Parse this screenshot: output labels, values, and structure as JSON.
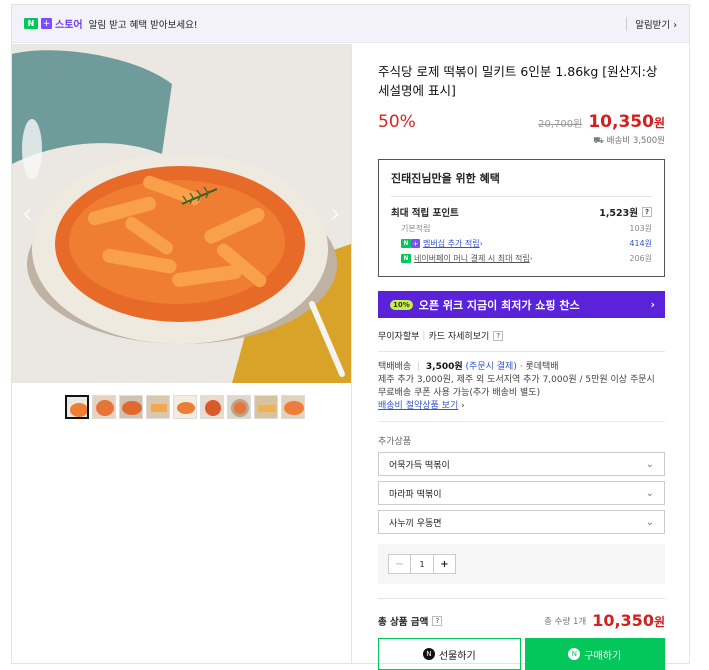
{
  "topbar": {
    "store_name": "스토어",
    "message": "알림 받고 혜택 받아보세요!",
    "alarm_label": "알림받기"
  },
  "product": {
    "title": "주식당 로제 떡볶이 밀키트 6인분 1.86kg [원산지:상세설명에 표시]",
    "discount": "50%",
    "original_price": "20,700원",
    "price": "10,350",
    "price_unit": "원",
    "shipping_fee": "배송비 3,500원"
  },
  "benefit": {
    "title": "진태진님만을 위한 혜택",
    "max_points_label": "최대 적립 포인트",
    "max_points_value": "1,523원",
    "basic_label": "기본적립",
    "basic_value": "103원",
    "membership_label": "멤버십 추가 적립",
    "membership_value": "414원",
    "npay_label": "네이버페이 머니 결제 시 최대 적립",
    "npay_value": "206원"
  },
  "banner": {
    "tag": "10%",
    "text": "오픈 위크 지금이 최저가 쇼핑 찬스"
  },
  "card": {
    "label": "무이자할부",
    "link": "카드 자세히보기"
  },
  "shipping": {
    "type": "택배배송",
    "fee": "3,500원",
    "pay": "(주문시 결제)",
    "carrier": "· 롯데택배",
    "desc": "제주 추가 3,000원, 제주 외 도서지역 추가 7,000원 / 5만원 이상 주문시 무료배송 쿠폰 사용 가능(추가 배송비 별도)",
    "link": "배송비 절약상품 보기"
  },
  "options": {
    "label": "추가상품",
    "items": [
      "어묵가득 떡볶이",
      "마라파 떡볶이",
      "사누끼 우동면"
    ]
  },
  "quantity": {
    "minus": "−",
    "value": "1",
    "plus": "+"
  },
  "total": {
    "label": "총 상품 금액",
    "count": "총 수량 1개",
    "price": "10,350",
    "unit": "원"
  },
  "buttons": {
    "gift": "선물하기",
    "buy": "구매하기"
  },
  "colors": {
    "accent": "#03c75a",
    "price": "#d21f1f",
    "banner": "#5a23d9"
  }
}
